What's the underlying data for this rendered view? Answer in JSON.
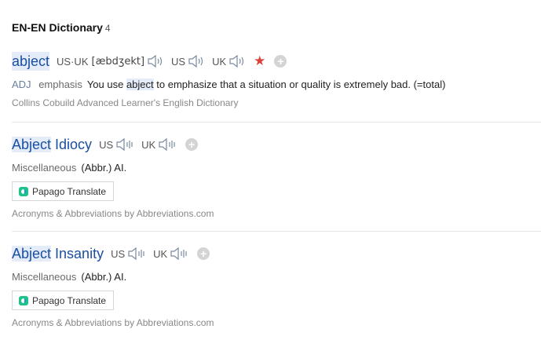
{
  "header": {
    "title": "EN-EN Dictionary",
    "count": "4"
  },
  "entries": [
    {
      "word": "abject",
      "pron_us_uk": "US·UK",
      "ipa": "[æbdʒekt]",
      "us_label": "US",
      "uk_label": "UK",
      "star_color": "#d9413a",
      "pos": "ADJ",
      "grammar": "emphasis",
      "def_before": "You use ",
      "def_highlight": "abject",
      "def_after": " to emphasize that a situation or quality is extremely bad. (=total)",
      "source": "Collins Cobuild Advanced Learner's English Dictionary"
    },
    {
      "word_highlight": "Abject",
      "word_rest": " Idiocy",
      "us_label": "US",
      "uk_label": "UK",
      "category": "Miscellaneous",
      "abbr": "(Abbr.) AI.",
      "translate_label": "Papago Translate",
      "source": "Acronyms & Abbreviations by Abbreviations.com"
    },
    {
      "word_highlight": "Abject",
      "word_rest": " Insanity",
      "us_label": "US",
      "uk_label": "UK",
      "category": "Miscellaneous",
      "abbr": "(Abbr.) AI.",
      "translate_label": "Papago Translate",
      "source": "Acronyms & Abbreviations by Abbreviations.com"
    }
  ],
  "icons": {
    "speaker": "speaker-icon",
    "star": "star-icon",
    "add": "add-icon",
    "papago": "papago-logo-icon"
  },
  "colors": {
    "accent": "#1a4fa0",
    "highlight": "#e3ecf8"
  }
}
